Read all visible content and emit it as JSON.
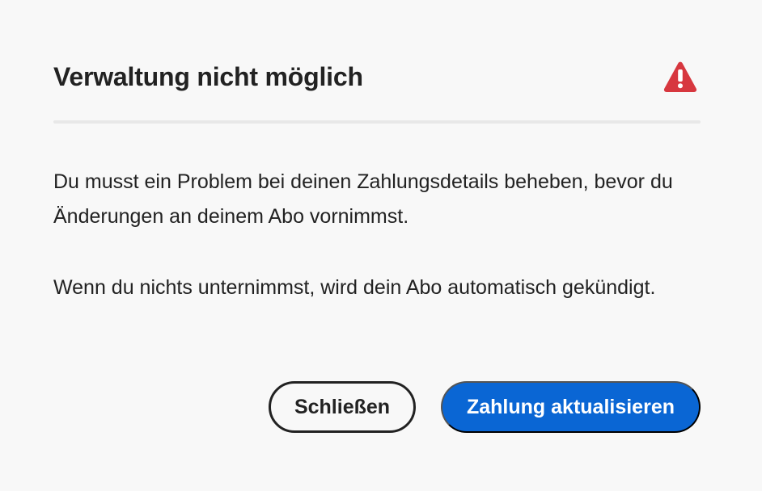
{
  "dialog": {
    "title": "Verwaltung nicht möglich",
    "icon": "warning-icon",
    "icon_color": "#d7373f",
    "message_1": "Du musst ein Problem bei deinen Zahlungsdetails beheben, bevor du Änderungen an deinem Abo vornimmst.",
    "message_2": "Wenn du nichts unternimmst, wird dein Abo automatisch gekündigt."
  },
  "actions": {
    "close_label": "Schließen",
    "update_payment_label": "Zahlung aktualisieren"
  },
  "colors": {
    "background": "#f8f8f8",
    "text": "#222222",
    "primary_button": "#0a66d4",
    "divider": "#e8e8e8"
  }
}
